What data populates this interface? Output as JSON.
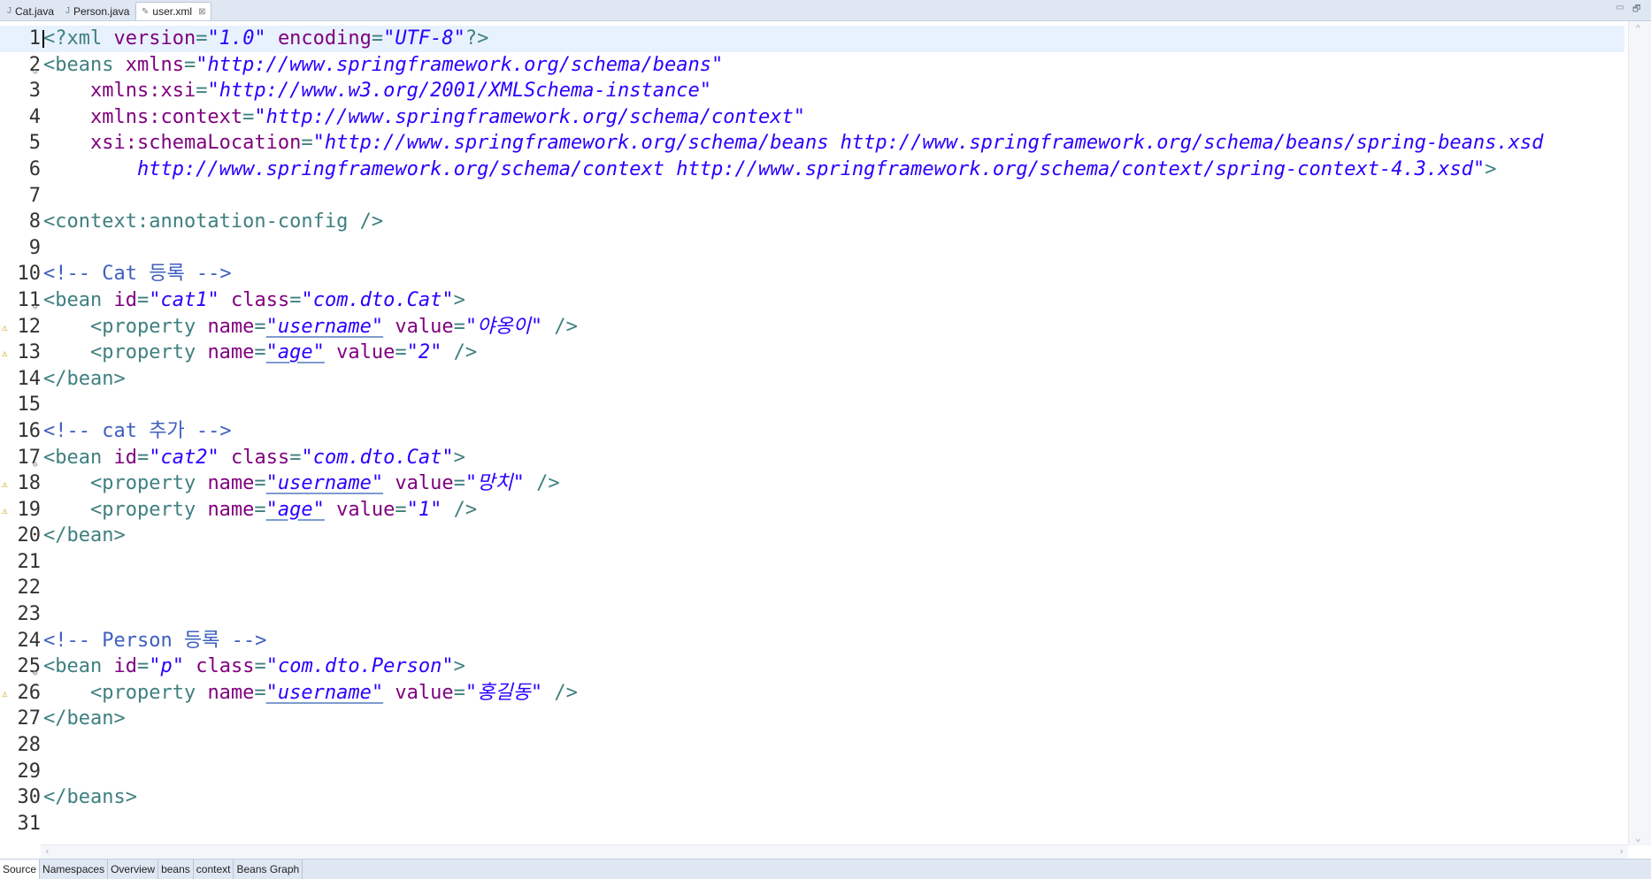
{
  "tabs": [
    {
      "label": "Cat.java",
      "icon": "java-file-icon",
      "active": false
    },
    {
      "label": "Person.java",
      "icon": "java-file-icon",
      "active": false
    },
    {
      "label": "user.xml",
      "icon": "xml-file-icon",
      "active": true,
      "close": "⊠"
    }
  ],
  "window_controls": {
    "minimize": "▭",
    "maximize": "🗗"
  },
  "editor": {
    "current_line": 1,
    "lines": [
      {
        "n": "1",
        "tokens": [
          [
            "pi",
            "<?xml "
          ],
          [
            "attr",
            "version"
          ],
          [
            "tag",
            "="
          ],
          [
            "val",
            "\"1.0\""
          ],
          [
            "tag",
            " "
          ],
          [
            "attr",
            "encoding"
          ],
          [
            "tag",
            "="
          ],
          [
            "val",
            "\"UTF-8\""
          ],
          [
            "pi",
            "?>"
          ]
        ]
      },
      {
        "n": "2",
        "fold": true,
        "tokens": [
          [
            "tag",
            "<beans "
          ],
          [
            "attr",
            "xmlns"
          ],
          [
            "tag",
            "="
          ],
          [
            "val",
            "\"http://www.springframework.org/schema/beans\""
          ]
        ]
      },
      {
        "n": "3",
        "tokens": [
          [
            "tag",
            "    "
          ],
          [
            "attr",
            "xmlns:xsi"
          ],
          [
            "tag",
            "="
          ],
          [
            "val",
            "\"http://www.w3.org/2001/XMLSchema-instance\""
          ]
        ]
      },
      {
        "n": "4",
        "tokens": [
          [
            "tag",
            "    "
          ],
          [
            "attr",
            "xmlns:context"
          ],
          [
            "tag",
            "="
          ],
          [
            "val",
            "\"http://www.springframework.org/schema/context\""
          ]
        ]
      },
      {
        "n": "5",
        "tokens": [
          [
            "tag",
            "    "
          ],
          [
            "attr",
            "xsi:schemaLocation"
          ],
          [
            "tag",
            "="
          ],
          [
            "val",
            "\"http://www.springframework.org/schema/beans http://www.springframework.org/schema/beans/spring-beans.xsd"
          ]
        ]
      },
      {
        "n": "6",
        "tokens": [
          [
            "val",
            "        http://www.springframework.org/schema/context http://www.springframework.org/schema/context/spring-context-4.3.xsd\""
          ],
          [
            "tag",
            ">"
          ]
        ]
      },
      {
        "n": "7",
        "tokens": []
      },
      {
        "n": "8",
        "tokens": [
          [
            "tag",
            "<context:annotation-config />"
          ]
        ]
      },
      {
        "n": "9",
        "tokens": []
      },
      {
        "n": "10",
        "tokens": [
          [
            "cmt",
            "<!-- Cat 등록 -->"
          ]
        ]
      },
      {
        "n": "11",
        "fold": true,
        "tokens": [
          [
            "tag",
            "<bean "
          ],
          [
            "attr",
            "id"
          ],
          [
            "tag",
            "="
          ],
          [
            "val",
            "\"cat1\""
          ],
          [
            "tag",
            " "
          ],
          [
            "attr",
            "class"
          ],
          [
            "tag",
            "="
          ],
          [
            "val",
            "\"com.dto.Cat\""
          ],
          [
            "tag",
            ">"
          ]
        ]
      },
      {
        "n": "12",
        "mark": true,
        "tokens": [
          [
            "tag",
            "    <property "
          ],
          [
            "attr",
            "name"
          ],
          [
            "tag",
            "="
          ],
          [
            "valu",
            "\"username\""
          ],
          [
            "tag",
            " "
          ],
          [
            "attr",
            "value"
          ],
          [
            "tag",
            "="
          ],
          [
            "val",
            "\"야옹이\""
          ],
          [
            "tag",
            " />"
          ]
        ]
      },
      {
        "n": "13",
        "mark": true,
        "tokens": [
          [
            "tag",
            "    <property "
          ],
          [
            "attr",
            "name"
          ],
          [
            "tag",
            "="
          ],
          [
            "valu",
            "\"age\""
          ],
          [
            "tag",
            " "
          ],
          [
            "attr",
            "value"
          ],
          [
            "tag",
            "="
          ],
          [
            "val",
            "\"2\""
          ],
          [
            "tag",
            " />"
          ]
        ]
      },
      {
        "n": "14",
        "tokens": [
          [
            "tag",
            "</bean>"
          ]
        ]
      },
      {
        "n": "15",
        "tokens": []
      },
      {
        "n": "16",
        "tokens": [
          [
            "cmt",
            "<!-- cat 추가 -->"
          ]
        ]
      },
      {
        "n": "17",
        "fold": true,
        "tokens": [
          [
            "tag",
            "<bean "
          ],
          [
            "attr",
            "id"
          ],
          [
            "tag",
            "="
          ],
          [
            "val",
            "\"cat2\""
          ],
          [
            "tag",
            " "
          ],
          [
            "attr",
            "class"
          ],
          [
            "tag",
            "="
          ],
          [
            "val",
            "\"com.dto.Cat\""
          ],
          [
            "tag",
            ">"
          ]
        ]
      },
      {
        "n": "18",
        "mark": true,
        "tokens": [
          [
            "tag",
            "    <property "
          ],
          [
            "attr",
            "name"
          ],
          [
            "tag",
            "="
          ],
          [
            "valu",
            "\"username\""
          ],
          [
            "tag",
            " "
          ],
          [
            "attr",
            "value"
          ],
          [
            "tag",
            "="
          ],
          [
            "val",
            "\"망치\""
          ],
          [
            "tag",
            " />"
          ]
        ]
      },
      {
        "n": "19",
        "mark": true,
        "tokens": [
          [
            "tag",
            "    <property "
          ],
          [
            "attr",
            "name"
          ],
          [
            "tag",
            "="
          ],
          [
            "valu",
            "\"age\""
          ],
          [
            "tag",
            " "
          ],
          [
            "attr",
            "value"
          ],
          [
            "tag",
            "="
          ],
          [
            "val",
            "\"1\""
          ],
          [
            "tag",
            " />"
          ]
        ]
      },
      {
        "n": "20",
        "tokens": [
          [
            "tag",
            "</bean>"
          ]
        ]
      },
      {
        "n": "21",
        "tokens": []
      },
      {
        "n": "22",
        "tokens": []
      },
      {
        "n": "23",
        "tokens": []
      },
      {
        "n": "24",
        "tokens": [
          [
            "cmt",
            "<!-- Person 등록 -->"
          ]
        ]
      },
      {
        "n": "25",
        "fold": true,
        "tokens": [
          [
            "tag",
            "<bean "
          ],
          [
            "attr",
            "id"
          ],
          [
            "tag",
            "="
          ],
          [
            "val",
            "\"p\""
          ],
          [
            "tag",
            " "
          ],
          [
            "attr",
            "class"
          ],
          [
            "tag",
            "="
          ],
          [
            "val",
            "\"com.dto.Person\""
          ],
          [
            "tag",
            ">"
          ]
        ]
      },
      {
        "n": "26",
        "mark": true,
        "tokens": [
          [
            "tag",
            "    <property "
          ],
          [
            "attr",
            "name"
          ],
          [
            "tag",
            "="
          ],
          [
            "valu",
            "\"username\""
          ],
          [
            "tag",
            " "
          ],
          [
            "attr",
            "value"
          ],
          [
            "tag",
            "="
          ],
          [
            "val",
            "\"홍길동\""
          ],
          [
            "tag",
            " />"
          ]
        ]
      },
      {
        "n": "27",
        "tokens": [
          [
            "tag",
            "</bean>"
          ]
        ]
      },
      {
        "n": "28",
        "tokens": []
      },
      {
        "n": "29",
        "tokens": []
      },
      {
        "n": "30",
        "tokens": [
          [
            "tag",
            "</beans>"
          ]
        ]
      },
      {
        "n": "31",
        "tokens": []
      }
    ]
  },
  "bottom_tabs": [
    {
      "label": "Source",
      "active": true
    },
    {
      "label": "Namespaces",
      "active": false
    },
    {
      "label": "Overview",
      "active": false
    },
    {
      "label": "beans",
      "active": false
    },
    {
      "label": "context",
      "active": false
    },
    {
      "label": "Beans Graph",
      "active": false
    }
  ],
  "colors": {
    "tag": "#3f7f7f",
    "attribute": "#7f007f",
    "value": "#2a00ff",
    "comment": "#3f5fbf",
    "current_line": "#e8f2fe",
    "tabbar": "#dfe7f3"
  }
}
